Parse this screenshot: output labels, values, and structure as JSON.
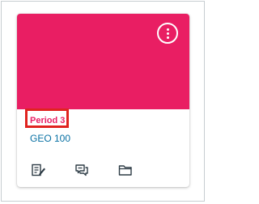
{
  "card": {
    "term": "Period 3",
    "course_code": "GEO 100",
    "hero_color": "#e91e63",
    "highlight_color": "#e0231f",
    "menu_icon": "kebab-menu-icon"
  },
  "actions": [
    {
      "icon": "assignments-icon"
    },
    {
      "icon": "discussions-icon"
    },
    {
      "icon": "files-icon"
    }
  ]
}
